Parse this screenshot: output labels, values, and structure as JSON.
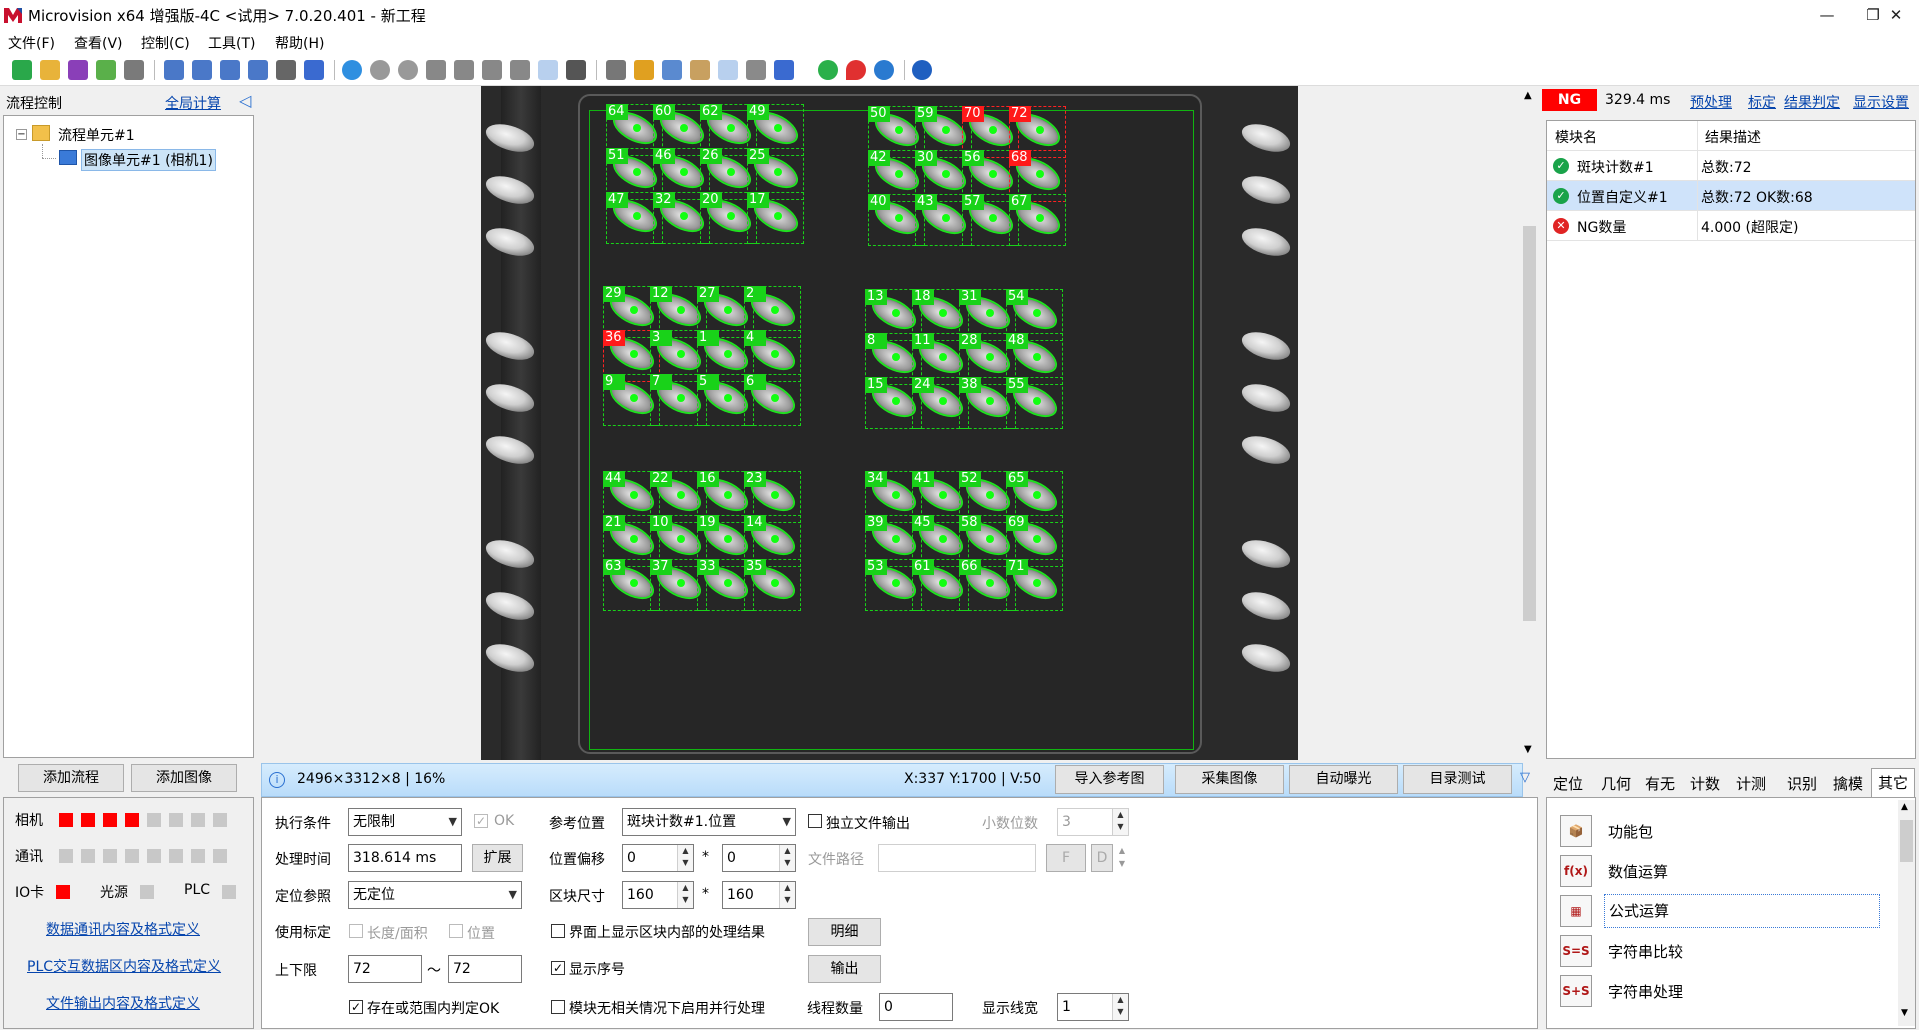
{
  "window": {
    "title": "Microvision x64 增强版-4C <试用> 7.0.20.401 - 新工程",
    "minimize": "—",
    "maximize": "❐",
    "close": "✕"
  },
  "menu": [
    "文件(F)",
    "查看(V)",
    "控制(C)",
    "工具(T)",
    "帮助(H)"
  ],
  "flow_panel": {
    "title": "流程控制",
    "global_calc": "全局计算",
    "tree_root": "流程单元#1",
    "tree_child": "图像单元#1 (相机1)",
    "add_flow": "添加流程",
    "add_image": "添加图像"
  },
  "status_panel": {
    "camera_label": "相机",
    "comm_label": "通讯",
    "io_label": "IO卡",
    "light_label": "光源",
    "plc_label": "PLC",
    "camera_states": [
      "red",
      "red",
      "red",
      "red",
      "gray",
      "gray",
      "gray",
      "gray"
    ],
    "comm_states": [
      "gray",
      "gray",
      "gray",
      "gray",
      "gray",
      "gray",
      "gray",
      "gray"
    ],
    "link1": "数据通讯内容及格式定义",
    "link2": "PLC交互数据区内容及格式定义",
    "link3": "文件输出内容及格式定义"
  },
  "image_info": {
    "info_icon": "info-icon",
    "size_text": "2496×3312×8 | 16%",
    "coords": "X:337 Y:1700 | V:50",
    "btn_import": "导入参考图",
    "btn_capture": "采集图像",
    "btn_exposure": "自动曝光",
    "btn_dir_test": "目录测试"
  },
  "result_panel": {
    "status": "NG",
    "time": "329.4 ms",
    "links": [
      "预处理",
      "标定",
      "结果判定",
      "显示设置"
    ],
    "col_name": "模块名",
    "col_desc": "结果描述",
    "rows": [
      {
        "status": "ok",
        "name": "斑块计数#1",
        "desc": "总数:72"
      },
      {
        "status": "ok",
        "name": "位置自定义#1",
        "desc": "总数:72 OK数:68"
      },
      {
        "status": "ng",
        "name": "NG数量",
        "desc": "4.000 (超限定)"
      }
    ]
  },
  "settings": {
    "exec_cond_label": "执行条件",
    "exec_cond_value": "无限制",
    "ok_label": "OK",
    "proc_time_label": "处理时间",
    "proc_time_value": "318.614 ms",
    "expand_btn": "扩展",
    "locate_ref_label": "定位参照",
    "locate_ref_value": "无定位",
    "use_calib_label": "使用标定",
    "len_area_label": "长度/面积",
    "pos_label": "位置",
    "limits_label": "上下限",
    "lower_limit": "72",
    "tilde": "～",
    "upper_limit": "72",
    "exist_label": "存在或范围内判定OK",
    "ref_pos_label": "参考位置",
    "ref_pos_value": "斑块计数#1.位置",
    "independent_label": "独立文件输出",
    "decimals_label": "小数位数",
    "decimals_value": "3",
    "pos_offset_label": "位置偏移",
    "offset_x": "0",
    "offset_y": "0",
    "times": "*",
    "file_path_label": "文件路径",
    "f_btn": "F",
    "d_btn": "D",
    "block_size_label": "区块尺寸",
    "block_w": "160",
    "block_h": "160",
    "show_inner_label": "界面上显示区块内部的处理结果",
    "detail_btn": "明细",
    "show_index_label": "显示序号",
    "output_btn": "输出",
    "parallel_label": "模块无相关情况下启用并行处理",
    "threads_label": "线程数量",
    "threads_value": "0",
    "line_width_label": "显示线宽",
    "line_width_value": "1"
  },
  "tool_tabs": [
    "定位",
    "几何",
    "有无",
    "计数",
    "计测",
    "识别",
    "擒模",
    "其它"
  ],
  "tools": [
    {
      "icon": "package-icon",
      "glyph": "📦",
      "label": "功能包"
    },
    {
      "icon": "function-icon",
      "glyph": "f(x)",
      "label": "数值运算"
    },
    {
      "icon": "calculator-icon",
      "glyph": "▦",
      "label": "公式运算"
    },
    {
      "icon": "string-compare-icon",
      "glyph": "S=S",
      "label": "字符串比较"
    },
    {
      "icon": "string-process-icon",
      "glyph": "S+S",
      "label": "字符串处理"
    }
  ],
  "blobs": {
    "left_top": [
      [
        "64",
        "60",
        "62",
        "49"
      ],
      [
        "51",
        "46",
        "26",
        "25"
      ],
      [
        "47",
        "32",
        "20",
        "17"
      ]
    ],
    "right_top": [
      [
        "50",
        "59",
        "70",
        "72"
      ],
      [
        "42",
        "30",
        "56",
        "68"
      ],
      [
        "40",
        "43",
        "57",
        "67"
      ]
    ],
    "left_mid": [
      [
        "29",
        "12",
        "27",
        "2"
      ],
      [
        "36",
        "3",
        "1",
        "4"
      ],
      [
        "9",
        "7",
        "5",
        "6"
      ]
    ],
    "right_mid": [
      [
        "13",
        "18",
        "31",
        "54"
      ],
      [
        "8",
        "11",
        "28",
        "48"
      ],
      [
        "15",
        "24",
        "38",
        "55"
      ]
    ],
    "left_bot": [
      [
        "44",
        "22",
        "16",
        "23"
      ],
      [
        "21",
        "10",
        "19",
        "14"
      ],
      [
        "63",
        "37",
        "33",
        "35"
      ]
    ],
    "right_bot": [
      [
        "34",
        "41",
        "52",
        "65"
      ],
      [
        "39",
        "45",
        "58",
        "69"
      ],
      [
        "53",
        "61",
        "66",
        "71"
      ]
    ],
    "ng_numbers": [
      "70",
      "72",
      "68",
      "36"
    ]
  }
}
